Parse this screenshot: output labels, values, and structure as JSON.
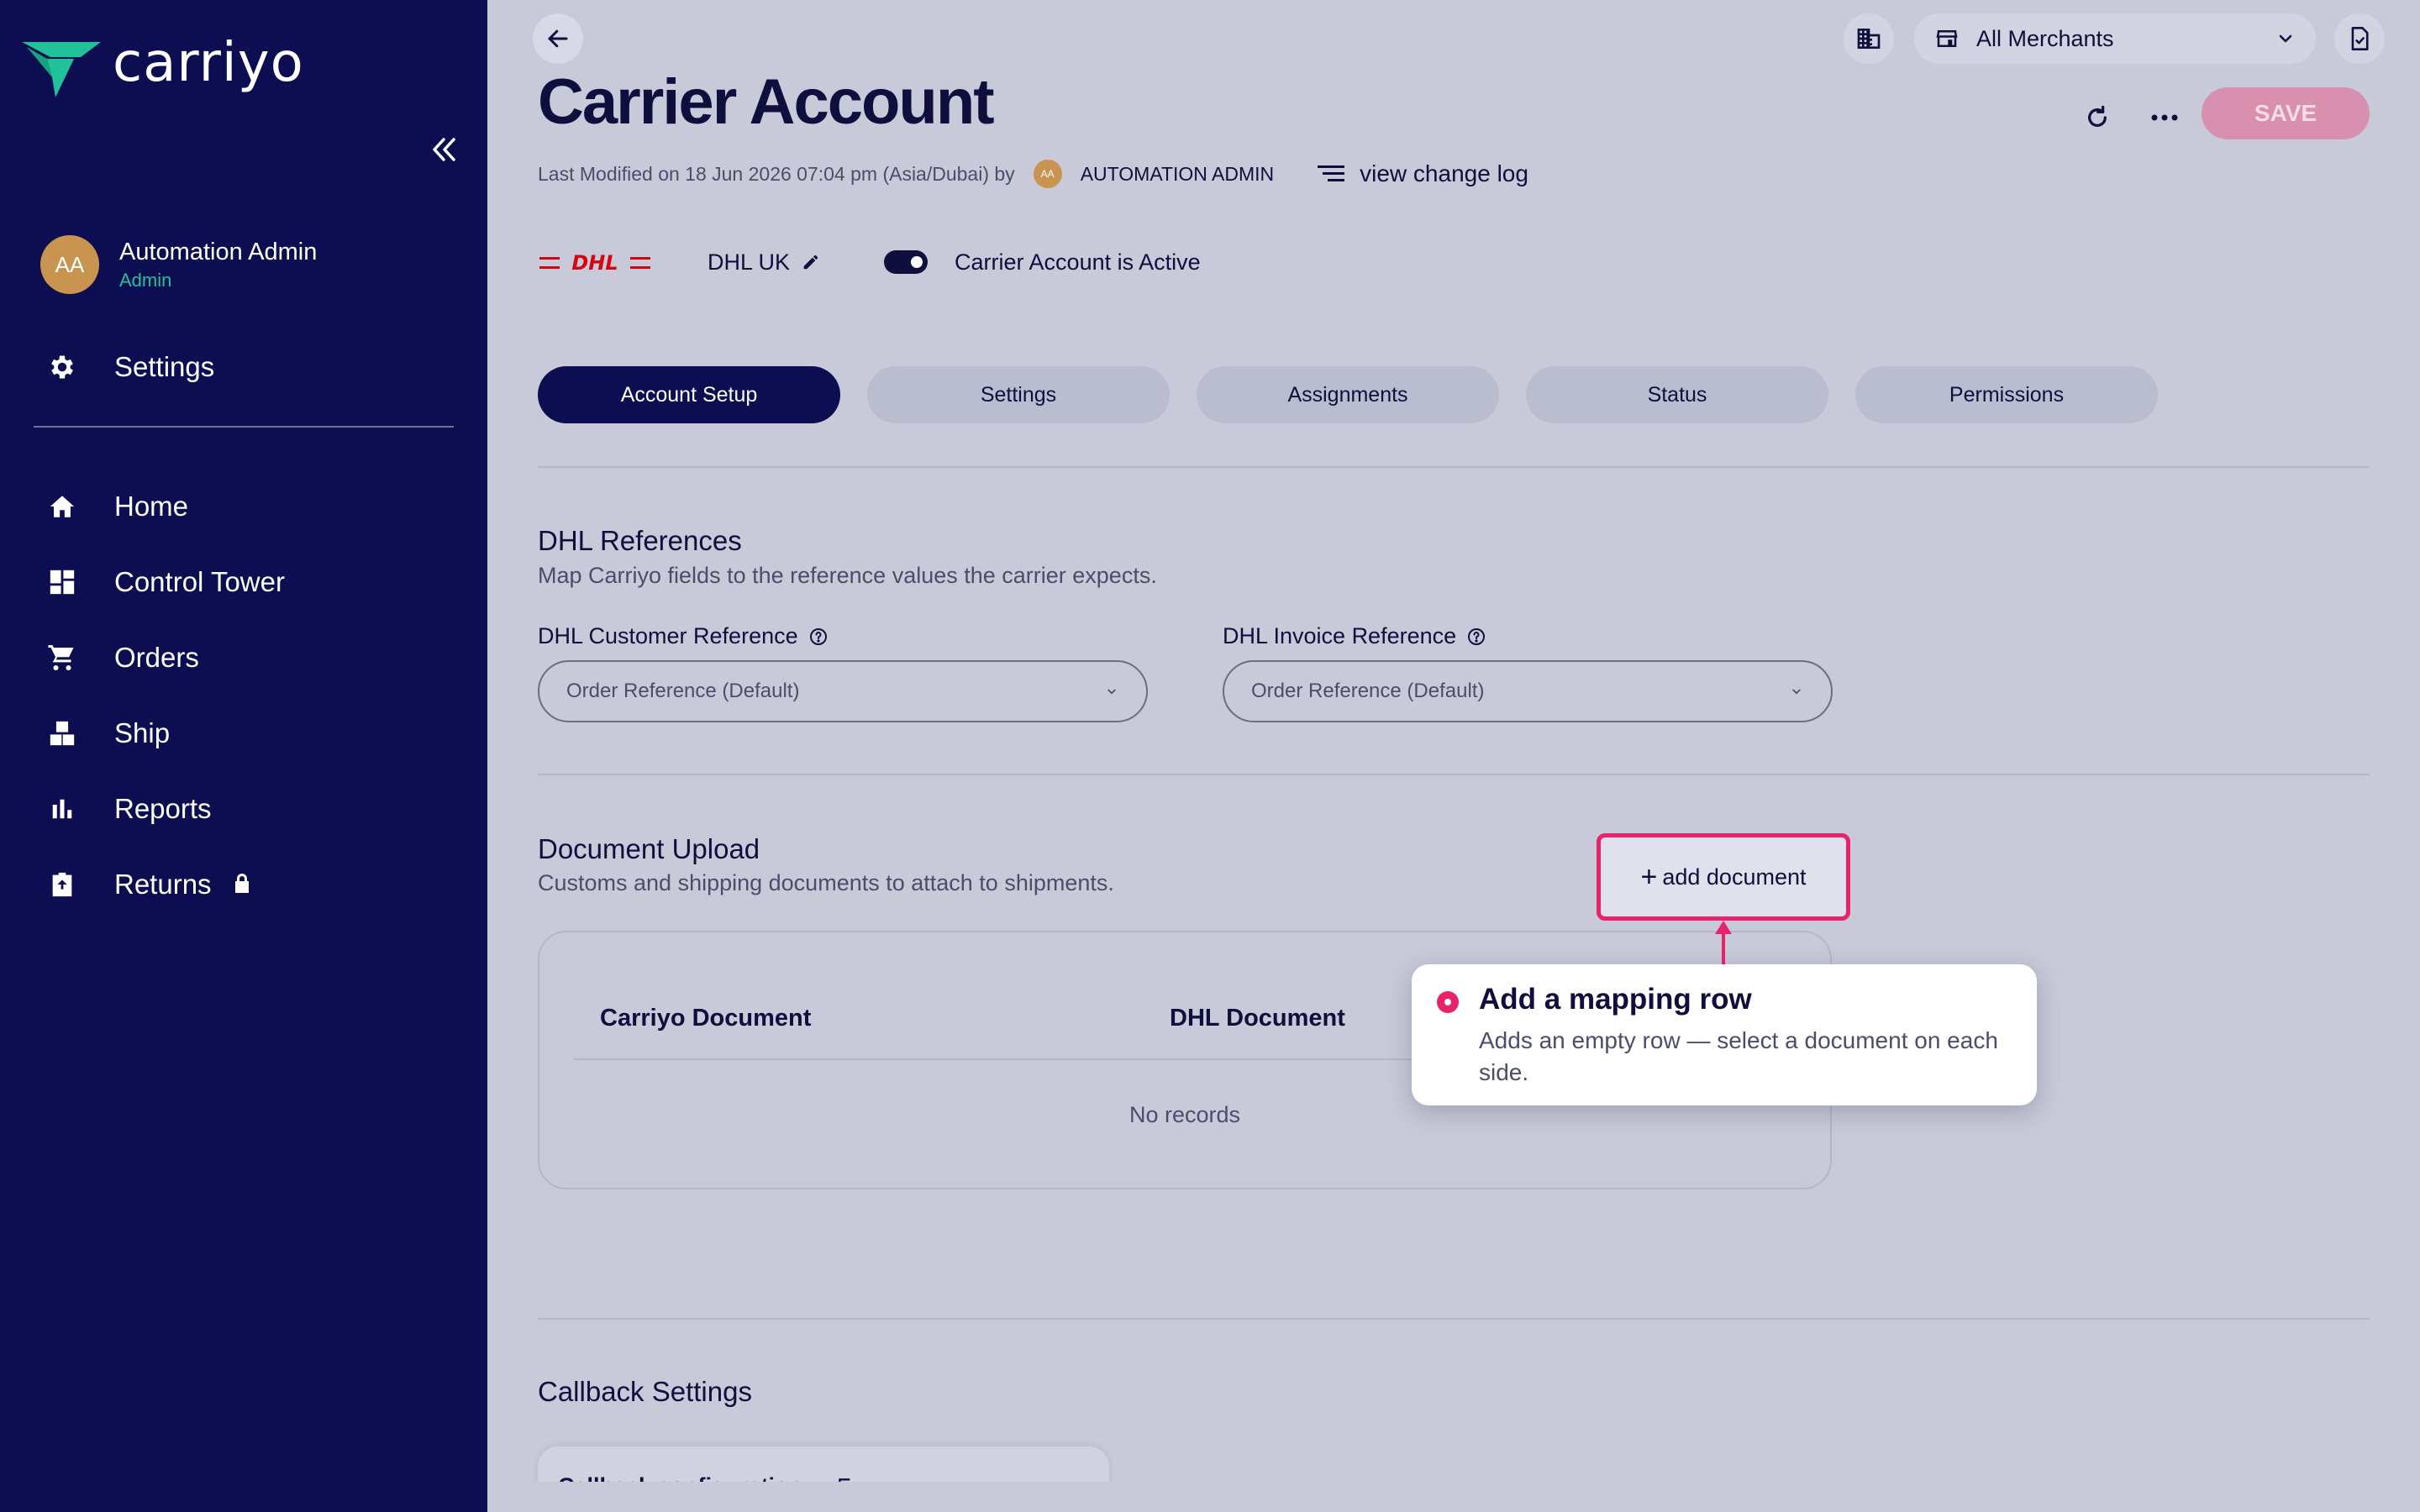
{
  "sidebar": {
    "brand": "carriyo",
    "user": {
      "initials": "AA",
      "name": "Automation Admin",
      "role": "Admin"
    },
    "settings_label": "Settings",
    "items": [
      {
        "label": "Home",
        "icon": "home-icon"
      },
      {
        "label": "Control Tower",
        "icon": "dashboard-icon"
      },
      {
        "label": "Orders",
        "icon": "cart-icon"
      },
      {
        "label": "Ship",
        "icon": "boxes-icon"
      },
      {
        "label": "Reports",
        "icon": "bar-chart-icon"
      },
      {
        "label": "Returns",
        "icon": "return-box-icon",
        "locked": true
      }
    ]
  },
  "topbar": {
    "merchant_select": "All Merchants"
  },
  "page": {
    "title": "Carrier Account",
    "save_label": "SAVE",
    "modified_text": "Last Modified on 18 Jun 2026 07:04 pm (Asia/Dubai) by",
    "modified_initials": "AA",
    "modified_user": "AUTOMATION ADMIN",
    "changelog_label": "view change log"
  },
  "carrier": {
    "logo_text": "DHL",
    "name": "DHL UK",
    "active_label": "Carrier Account is Active",
    "active": true
  },
  "tabs": [
    {
      "label": "Account Setup",
      "active": true
    },
    {
      "label": "Settings",
      "active": false
    },
    {
      "label": "Assignments",
      "active": false
    },
    {
      "label": "Status",
      "active": false
    },
    {
      "label": "Permissions",
      "active": false
    }
  ],
  "references": {
    "title": "DHL References",
    "subtitle": "Map Carriyo fields to the reference values the carrier expects.",
    "customer_label": "DHL Customer Reference",
    "customer_value": "Order Reference (Default)",
    "invoice_label": "DHL Invoice Reference",
    "invoice_value": "Order Reference (Default)"
  },
  "documents": {
    "title": "Document Upload",
    "subtitle": "Customs and shipping documents to attach to shipments.",
    "add_label": "add document",
    "columns": [
      "Carriyo Document",
      "DHL Document"
    ],
    "empty_text": "No records"
  },
  "tooltip": {
    "title": "Add a mapping row",
    "body": "Adds an empty row — select a document on each side."
  },
  "callback": {
    "title": "Callback Settings",
    "card_label": "Callback configuration:"
  },
  "colors": {
    "sidebar": "#0d0d52",
    "accent": "#e8236c",
    "brand_green": "#21c29a",
    "save": "#d98fae",
    "dhl_red": "#d40511"
  }
}
